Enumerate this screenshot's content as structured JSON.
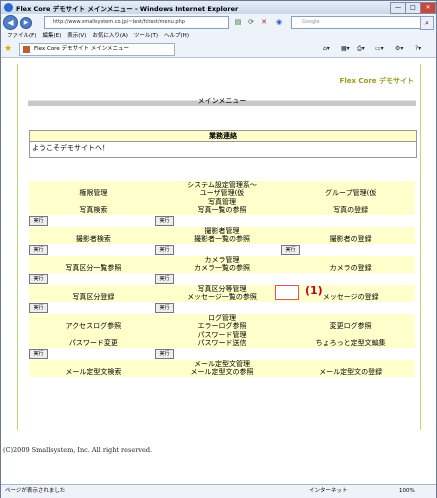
{
  "window": {
    "title": "Flex Core デモサイト メインメニュー - Windows Internet Explorer"
  },
  "address": {
    "url": "http://www.smallsystem.co.jp/~test/fctest/menu.php",
    "search_placeholder": "Google"
  },
  "menubar": [
    "ファイル(F)",
    "編集(E)",
    "表示(V)",
    "お気に入り(A)",
    "ツール(T)",
    "ヘルプ(H)"
  ],
  "tab": {
    "label": "Flex Core デモサイト メインメニュー"
  },
  "page": {
    "brand": "Flex Core デモサイト",
    "menu_title": "メインメニュー",
    "gyomu_header": "業務連絡",
    "gyomu_body": "ようこそデモサイトへ！",
    "exec_label": "実行",
    "sections": [
      {
        "title": "システム設定管理系～",
        "items": [
          "権限管理",
          "ユーザ管理(仮",
          "グループ管理(仮"
        ],
        "buttons": []
      },
      {
        "title": "写真管理",
        "items": [
          "写真検索",
          "写真一覧の参照",
          "写真の登録"
        ],
        "buttons": [
          0,
          1
        ]
      },
      {
        "title": "撮影者管理",
        "items": [
          "撮影者検索",
          "撮影者一覧の参照",
          "撮影者の登録"
        ],
        "buttons": [
          0,
          1,
          2
        ]
      },
      {
        "title": "カメラ管理",
        "items": [
          "写真区分一覧参照",
          "カメラ一覧の参照",
          "カメラの登録"
        ],
        "buttons": [
          0,
          1
        ]
      },
      {
        "title": "写真区分等管理",
        "items": [
          "写真区分登録",
          "メッセージ一覧の参照",
          "メッセージの登録"
        ],
        "buttons": [
          0,
          1
        ]
      },
      {
        "title": "ログ管理",
        "items": [
          "アクセスログ参照",
          "エラーログ参照",
          "変更ログ参照"
        ],
        "buttons": []
      },
      {
        "title": "パスワード管理",
        "items": [
          "パスワード変更",
          "パスワード送信",
          "ちょろっと定型文編集"
        ],
        "buttons": [
          0,
          1
        ]
      },
      {
        "title": "メール定型文管理",
        "items": [
          "メール定型文検索",
          "メール定型文の参照",
          "メール定型文の登録"
        ],
        "buttons": []
      }
    ],
    "annotation": "(1)",
    "copyright": "(C)2009 Smallsystem, Inc. All right reserved."
  },
  "status": {
    "left": "ページが表示されました",
    "zone": "インターネット",
    "zoom": "100%"
  }
}
